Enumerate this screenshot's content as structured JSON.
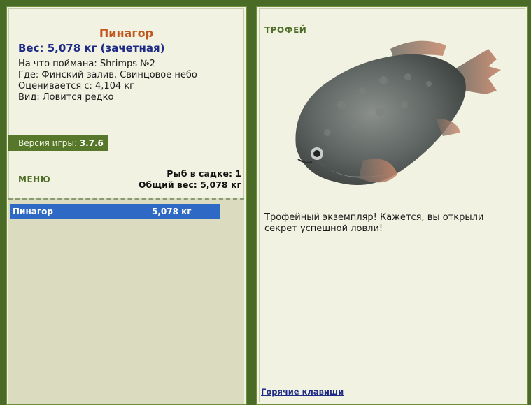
{
  "catch": {
    "fish_name": "Пинагор",
    "weight_line": "Вес: 5,078 кг (зачетная)",
    "bait": "На что поймана: Shrimps №2",
    "location": "Где: Финский залив, Свинцовое небо",
    "valued_from": "Оценивается с: 4,104 кг",
    "kind": "Вид: Ловится редко"
  },
  "version": {
    "label": "Версия игры:",
    "value": "3.7.6"
  },
  "menu": {
    "label": "МЕНЮ"
  },
  "stats": {
    "fish_in_keepnet": "Рыб в садке: 1",
    "total_weight": "Общий вес: 5,078 кг"
  },
  "keepnet": {
    "items": [
      {
        "name": "Пинагор",
        "weight": "5,078 кг"
      }
    ]
  },
  "trophy": {
    "label": "ТРОФЕЙ",
    "message": "Трофейный экземпляр! Кажется, вы открыли секрет успешной ловли!"
  },
  "footer": {
    "hotkeys_link": "Горячие клавиши"
  },
  "colors": {
    "background": "#4a6b26",
    "panel": "#f2f2e2",
    "fish_title": "#c2561d",
    "weight_text": "#1d2b86",
    "selection": "#2e69c6",
    "accent_green": "#4e6d26"
  }
}
